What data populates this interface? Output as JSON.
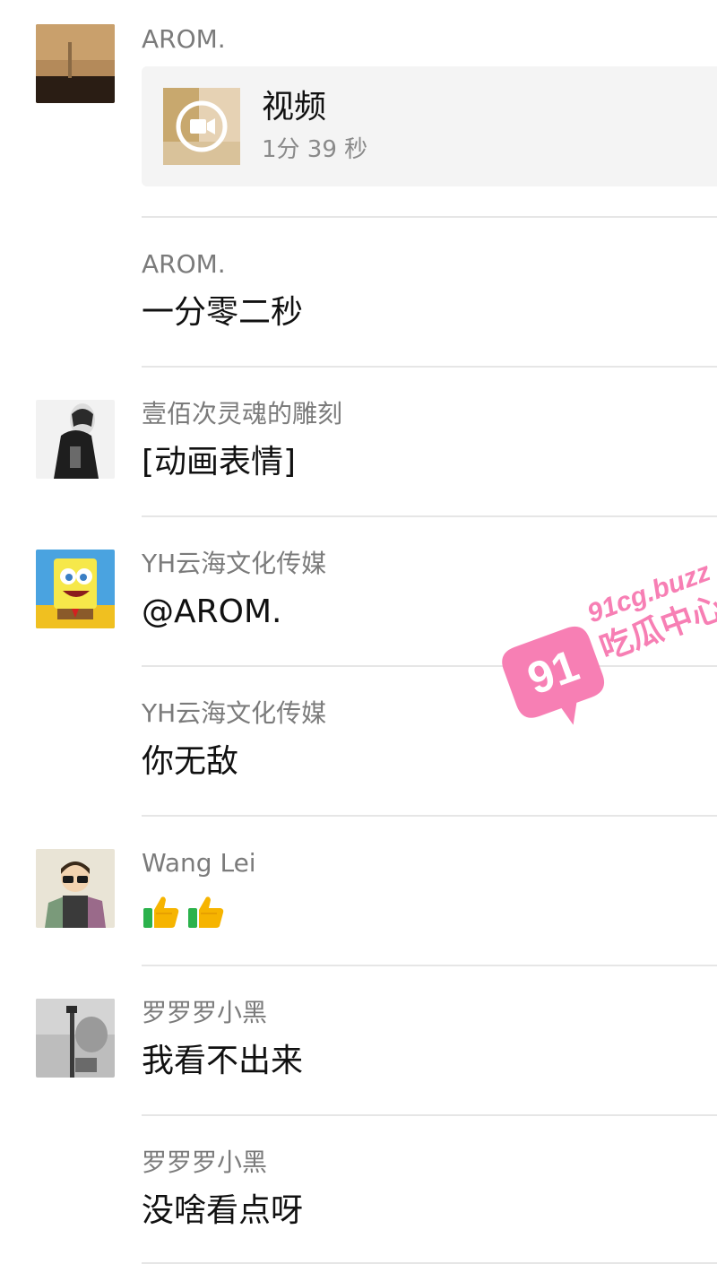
{
  "comments": [
    {
      "sender": "AROM.",
      "video": {
        "title": "视频",
        "duration": "1分 39 秒"
      }
    },
    {
      "sender": "AROM.",
      "text": "一分零二秒"
    },
    {
      "sender": "壹佰次灵魂的雕刻",
      "text": "[动画表情]"
    },
    {
      "sender": "YH云海文化传媒",
      "text": "@AROM."
    },
    {
      "sender": "YH云海文化传媒",
      "text": "你无敌"
    },
    {
      "sender": "Wang Lei",
      "emoji": [
        "thumbs-up",
        "thumbs-up"
      ]
    },
    {
      "sender": "罗罗罗小黑",
      "text": "我看不出来"
    },
    {
      "sender": "罗罗罗小黑",
      "text": "没啥看点呀"
    }
  ],
  "watermark": {
    "badge": "91",
    "domain": "91cg.buzz",
    "name": "吃瓜中心",
    "color": "#f77fb4"
  }
}
